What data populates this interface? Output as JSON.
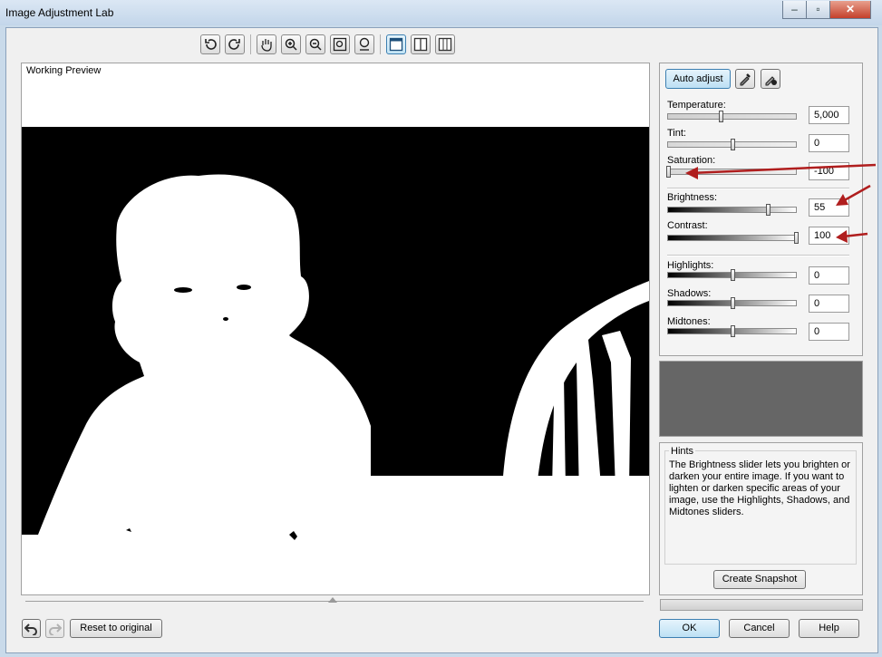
{
  "window": {
    "title": "Image Adjustment Lab"
  },
  "toolbar": {
    "buttons": [
      {
        "name": "rotate-left-icon"
      },
      {
        "name": "rotate-right-icon"
      },
      {
        "name": "pan-hand-icon"
      },
      {
        "name": "zoom-in-icon"
      },
      {
        "name": "zoom-out-icon"
      },
      {
        "name": "fit-to-window-icon"
      },
      {
        "name": "zoom-100-icon"
      },
      {
        "name": "single-view-icon"
      },
      {
        "name": "split-view-icon"
      },
      {
        "name": "side-by-side-view-icon"
      }
    ]
  },
  "preview": {
    "label": "Working Preview"
  },
  "panel": {
    "auto_adjust": "Auto adjust",
    "sliders": [
      {
        "label": "Temperature:",
        "value": "5,000",
        "level": 0.41
      },
      {
        "label": "Tint:",
        "value": "0",
        "level": 0.5
      },
      {
        "label": "Saturation:",
        "value": "-100",
        "level": 0.0
      },
      {
        "label": "Brightness:",
        "value": "55",
        "level": 0.78
      },
      {
        "label": "Contrast:",
        "value": "100",
        "level": 1.0
      },
      {
        "label": "Highlights:",
        "value": "0",
        "level": 0.5
      },
      {
        "label": "Shadows:",
        "value": "0",
        "level": 0.5
      },
      {
        "label": "Midtones:",
        "value": "0",
        "level": 0.5
      }
    ]
  },
  "hints": {
    "legend": "Hints",
    "text": "The Brightness slider lets you brighten or darken your entire image. If you want to lighten or darken specific areas of your image, use the Highlights, Shadows, and Midtones sliders.",
    "snapshot": "Create Snapshot"
  },
  "footer": {
    "reset": "Reset to original",
    "ok": "OK",
    "cancel": "Cancel",
    "help": "Help"
  },
  "colors": {
    "annotation_arrow": "#b01e1e",
    "preview_bg": "#000000"
  }
}
